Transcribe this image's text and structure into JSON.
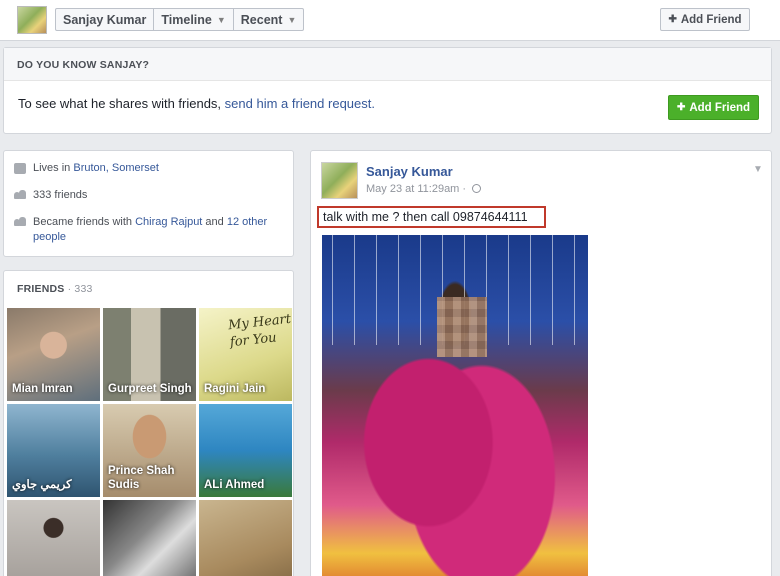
{
  "header": {
    "breadcrumbs": [
      {
        "label": "Sanjay Kumar",
        "has_caret": false
      },
      {
        "label": "Timeline",
        "has_caret": true
      },
      {
        "label": "Recent",
        "has_caret": true
      }
    ],
    "add_friend_label": "Add Friend"
  },
  "know": {
    "title": "DO YOU KNOW SANJAY?",
    "text_before": "To see what he shares with friends, ",
    "link_text": "send him a friend request.",
    "button_label": "Add Friend"
  },
  "intro": {
    "lives_prefix": "Lives in ",
    "lives_place": "Bruton, Somerset",
    "friends_count": "333 friends",
    "became_prefix": "Became friends with ",
    "became_person": "Chirag Rajput",
    "became_and": " and ",
    "became_others": "12 other people"
  },
  "friends": {
    "title": "FRIENDS",
    "count": " · 333",
    "items": [
      {
        "name": "Mian Imran"
      },
      {
        "name": "Gurpreet Singh"
      },
      {
        "name": "Ragini Jain"
      },
      {
        "name": "كريمي جاوي"
      },
      {
        "name": "Prince Shah Sudis"
      },
      {
        "name": "ALi Ahmed"
      },
      {
        "name": ""
      },
      {
        "name": ""
      },
      {
        "name": ""
      }
    ],
    "tile3_text": "My Heart for You"
  },
  "post": {
    "author": "Sanjay Kumar",
    "time": "May 23 at 11:29am · ",
    "text": "talk with me ? then call 09874644111"
  },
  "icons": {
    "add_friend": "add-friend-icon",
    "home": "home-icon",
    "people": "people-icon",
    "globe": "globe-icon",
    "chevron": "chevron-down-icon"
  },
  "colors": {
    "link": "#365899",
    "green_button": "#4bb02a",
    "highlight_border": "#c0392b"
  }
}
